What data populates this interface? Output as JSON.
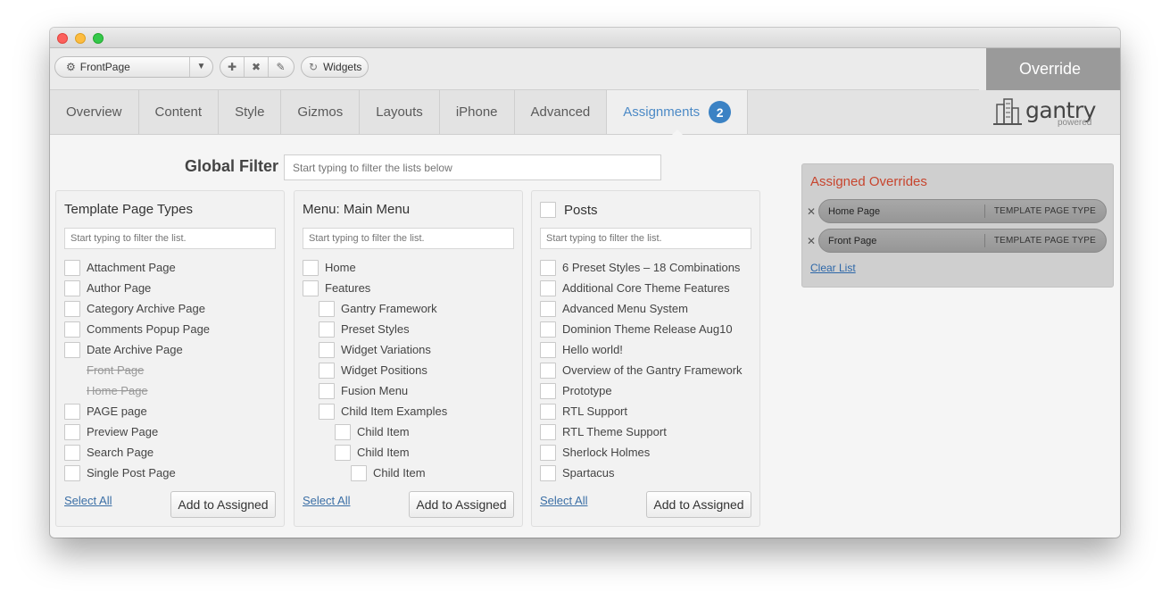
{
  "toolbar": {
    "selector_value": "FrontPage",
    "widgets_label": "Widgets",
    "override_label": "Override"
  },
  "tabs": [
    {
      "label": "Overview"
    },
    {
      "label": "Content"
    },
    {
      "label": "Style"
    },
    {
      "label": "Gizmos"
    },
    {
      "label": "Layouts"
    },
    {
      "label": "iPhone"
    },
    {
      "label": "Advanced"
    },
    {
      "label": "Assignments",
      "badge": "2"
    }
  ],
  "logo": {
    "word": "gantry",
    "sub": "powered"
  },
  "global_filter": {
    "label": "Global Filter",
    "placeholder": "Start typing to filter the lists below"
  },
  "panels": {
    "template": {
      "title": "Template Page Types",
      "placeholder": "Start typing to filter the list.",
      "items": [
        "Attachment Page",
        "Author Page",
        "Category Archive Page",
        "Comments Popup Page",
        "Date Archive Page",
        "Front Page",
        "Home Page",
        "PAGE page",
        "Preview Page",
        "Search Page",
        "Single Post Page"
      ],
      "select_all": "Select All",
      "add": "Add to Assigned"
    },
    "menu": {
      "title": "Menu: Main Menu",
      "placeholder": "Start typing to filter the list.",
      "items": [
        "Home",
        "Features",
        "Gantry Framework",
        "Preset Styles",
        "Widget Variations",
        "Widget Positions",
        "Fusion Menu",
        "Child Item Examples",
        "Child Item",
        "Child Item",
        "Child Item"
      ],
      "select_all": "Select All",
      "add": "Add to Assigned"
    },
    "posts": {
      "title": "Posts",
      "placeholder": "Start typing to filter the list.",
      "items": [
        "6 Preset Styles – 18 Combinations",
        "Additional Core Theme Features",
        "Advanced Menu System",
        "Dominion Theme Release Aug10",
        "Hello world!",
        "Overview of the Gantry Framework",
        "Prototype",
        "RTL Support",
        "RTL Theme Support",
        "Sherlock Holmes",
        "Spartacus"
      ],
      "select_all": "Select All",
      "add": "Add to Assigned"
    }
  },
  "assigned": {
    "title": "Assigned Overrides",
    "rows": [
      {
        "name": "Home Page",
        "type": "TEMPLATE PAGE TYPE"
      },
      {
        "name": "Front Page",
        "type": "TEMPLATE PAGE TYPE"
      }
    ],
    "clear": "Clear List"
  },
  "colors": {
    "accent": "#3b82c4",
    "assigned_title": "#c7452e",
    "link": "#3a6ea5"
  }
}
